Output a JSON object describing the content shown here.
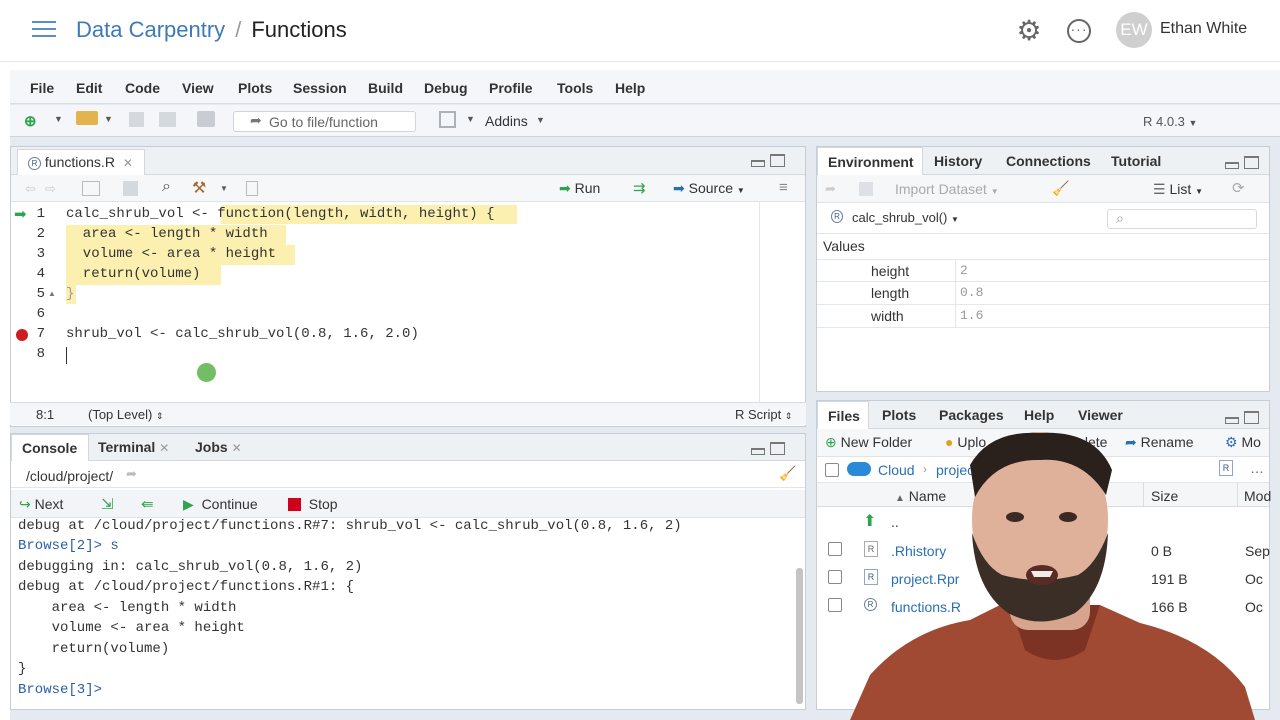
{
  "header": {
    "workspace": "Data Carpentry",
    "separator": "/",
    "project": "Functions",
    "avatar_initials": "EW",
    "user_name": "Ethan White"
  },
  "menu": [
    "File",
    "Edit",
    "Code",
    "View",
    "Plots",
    "Session",
    "Build",
    "Debug",
    "Profile",
    "Tools",
    "Help"
  ],
  "toolbar": {
    "goto_placeholder": "Go to file/function",
    "addins_label": "Addins",
    "r_version": "R 4.0.3"
  },
  "source_pane": {
    "file_tab": "functions.R",
    "run_label": "Run",
    "source_label": "Source",
    "lines": [
      {
        "num": "1",
        "text": "calc_shrub_vol <- function(length, width, height) {"
      },
      {
        "num": "2",
        "text": "  area <- length * width"
      },
      {
        "num": "3",
        "text": "  volume <- area * height"
      },
      {
        "num": "4",
        "text": "  return(volume)"
      },
      {
        "num": "5",
        "text": "}"
      },
      {
        "num": "6",
        "text": ""
      },
      {
        "num": "7",
        "text": "shrub_vol <- calc_shrub_vol(0.8, 1.6, 2.0)"
      },
      {
        "num": "8",
        "text": ""
      }
    ],
    "status_position": "8:1",
    "status_scope": "(Top Level)",
    "status_type": "R Script"
  },
  "console_pane": {
    "tabs": [
      "Console",
      "Terminal",
      "Jobs"
    ],
    "path": "/cloud/project/",
    "next_label": "Next",
    "continue_label": "Continue",
    "stop_label": "Stop",
    "lines": [
      "debug at /cloud/project/functions.R#7: shrub_vol <- calc_shrub_vol(0.8, 1.6, 2)",
      "Browse[2]> s",
      "debugging in: calc_shrub_vol(0.8, 1.6, 2)",
      "debug at /cloud/project/functions.R#1: {",
      "    area <- length * width",
      "    volume <- area * height",
      "    return(volume)",
      "}",
      "Browse[3]> "
    ]
  },
  "env_pane": {
    "tabs": [
      "Environment",
      "History",
      "Connections",
      "Tutorial"
    ],
    "import_label": "Import Dataset",
    "list_label": "List",
    "scope_label": "calc_shrub_vol()",
    "values_header": "Values",
    "rows": [
      {
        "name": "height",
        "value": "2"
      },
      {
        "name": "length",
        "value": "0.8"
      },
      {
        "name": "width",
        "value": "1.6"
      }
    ]
  },
  "files_pane": {
    "tabs": [
      "Files",
      "Plots",
      "Packages",
      "Help",
      "Viewer"
    ],
    "new_folder_label": "New Folder",
    "upload_label": "Uplo",
    "delete_label": "Delete",
    "rename_label": "Rename",
    "more_label": "Mo",
    "crumb_cloud": "Cloud",
    "crumb_project": "project",
    "col_name": "Name",
    "col_size": "Size",
    "col_modified": "Mod",
    "parent_label": "..",
    "files": [
      {
        "name": ".Rhistory",
        "size": "0 B",
        "modified": "Sep"
      },
      {
        "name": "project.Rpr",
        "size": "191 B",
        "modified": "Oc"
      },
      {
        "name": "functions.R",
        "size": "166 B",
        "modified": "Oc"
      }
    ]
  },
  "colors": {
    "accent": "#3d7ab8",
    "highlight": "#fbf0b0",
    "breakpoint": "#cc1f1f",
    "stop": "#d0021b"
  }
}
